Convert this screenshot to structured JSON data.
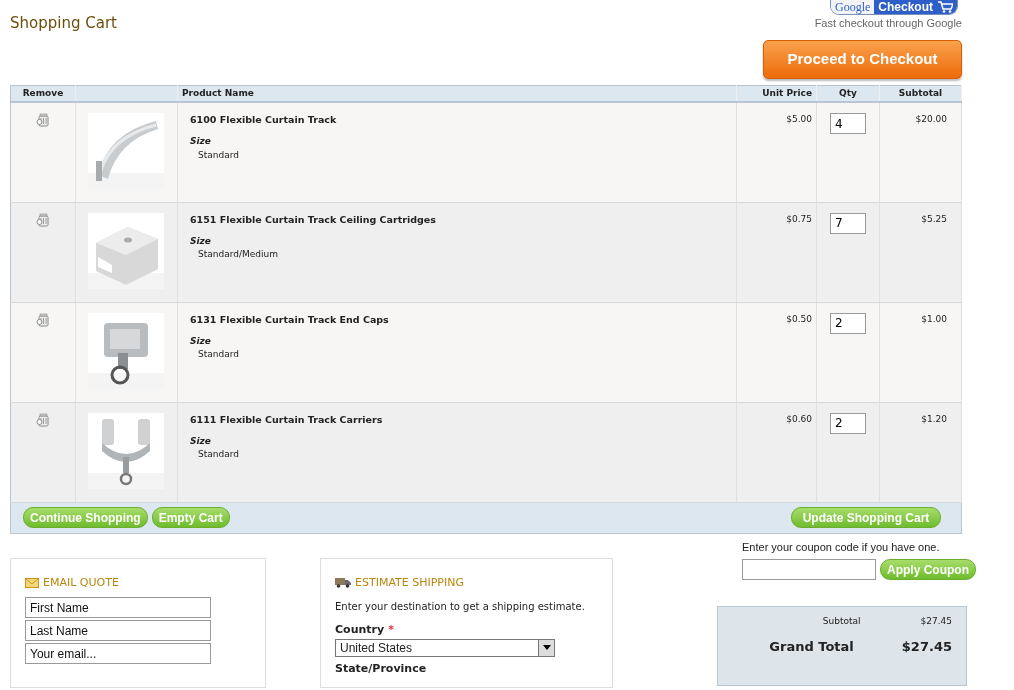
{
  "title": "Shopping Cart",
  "google_checkout": {
    "brand": "Google",
    "label": "Checkout",
    "caption": "Fast checkout through Google"
  },
  "proceed_button": "Proceed to Checkout",
  "table": {
    "columns": [
      "Remove",
      "",
      "Product Name",
      "Unit Price",
      "Qty",
      "Subtotal"
    ],
    "rows": [
      {
        "name": "6100 Flexible Curtain Track",
        "option_label": "Size",
        "option_value": "Standard",
        "unit_price": "$5.00",
        "qty": "4",
        "subtotal": "$20.00"
      },
      {
        "name": "6151 Flexible Curtain Track Ceiling Cartridges",
        "option_label": "Size",
        "option_value": "Standard/Medium",
        "unit_price": "$0.75",
        "qty": "7",
        "subtotal": "$5.25"
      },
      {
        "name": "6131 Flexible Curtain Track End Caps",
        "option_label": "Size",
        "option_value": "Standard",
        "unit_price": "$0.50",
        "qty": "2",
        "subtotal": "$1.00"
      },
      {
        "name": "6111 Flexible Curtain Track Carriers",
        "option_label": "Size",
        "option_value": "Standard",
        "unit_price": "$0.60",
        "qty": "2",
        "subtotal": "$1.20"
      }
    ]
  },
  "cart_buttons": {
    "left": [
      "Continue Shopping",
      "Empty Cart"
    ],
    "right": "Update Shopping Cart"
  },
  "email_quote": {
    "title": "EMAIL QUOTE",
    "fields": [
      {
        "placeholder": "First Name"
      },
      {
        "placeholder": "Last Name"
      },
      {
        "placeholder": "Your email..."
      }
    ]
  },
  "estimate_shipping": {
    "title": "ESTIMATE SHIPPING",
    "intro": "Enter your destination to get a shipping estimate.",
    "country_label": "Country",
    "required_mark": "*",
    "country_value": "United States",
    "state_label": "State/Province"
  },
  "coupon": {
    "prompt": "Enter your coupon code if you have one.",
    "button": "Apply Coupon"
  },
  "totals": {
    "subtotal_label": "Subtotal",
    "subtotal": "$27.45",
    "grand_label": "Grand Total",
    "grand_total": "$27.45"
  }
}
